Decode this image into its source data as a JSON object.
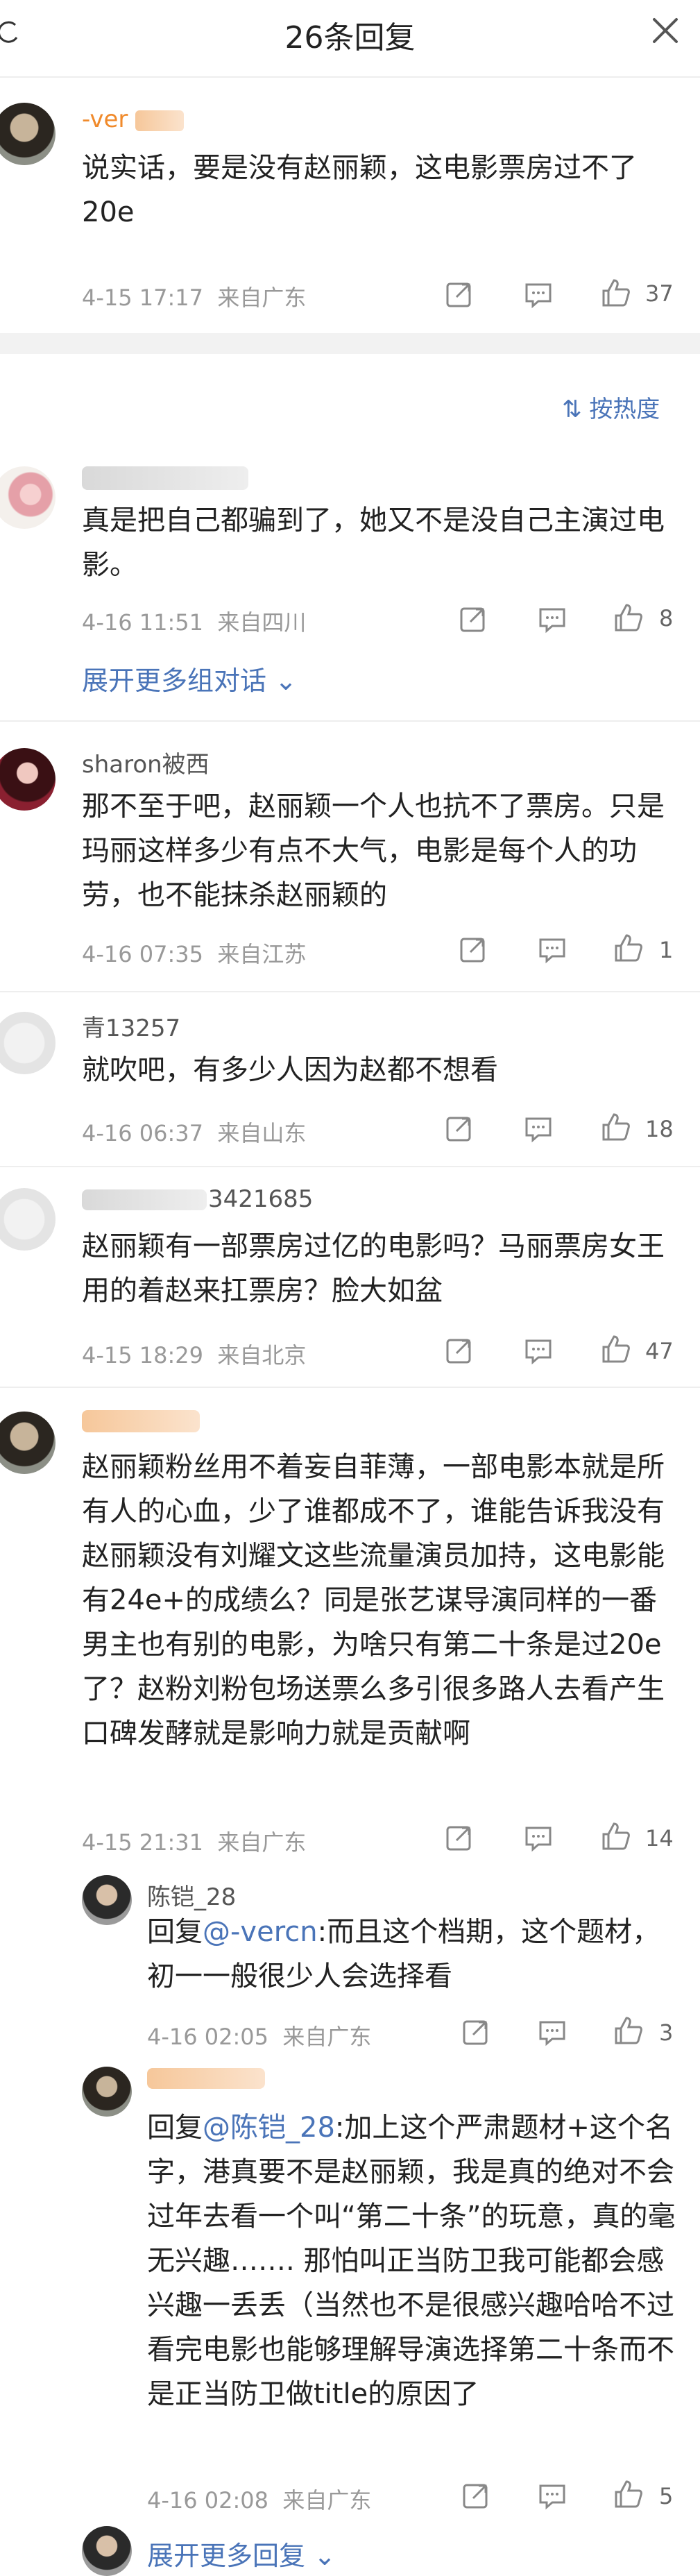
{
  "header": {
    "title": "26条回复"
  },
  "top_comment": {
    "username": "-ver",
    "text": "说实话，要是没有赵丽颖，这电影票房过不了20e",
    "time": "4-15 17:17",
    "location": "来自广东",
    "likes": "37"
  },
  "sort": {
    "label": "按热度"
  },
  "replies": [
    {
      "username": "",
      "text": "真是把自己都骗到了，她又不是没自己主演过电影。",
      "time": "4-16 11:51",
      "location": "来自四川",
      "likes": "8",
      "expand": "展开更多组对话"
    },
    {
      "username": "sharon被西",
      "text": "那不至于吧，赵丽颖一个人也抗不了票房。只是玛丽这样多少有点不大气，电影是每个人的功劳，也不能抹杀赵丽颖的",
      "time": "4-16 07:35",
      "location": "来自江苏",
      "likes": "1"
    },
    {
      "username": "青13257",
      "text": "就吹吧，有多少人因为赵都不想看",
      "time": "4-16 06:37",
      "location": "来自山东",
      "likes": "18"
    },
    {
      "username": "3421685",
      "text": "赵丽颖有一部票房过亿的电影吗？马丽票房女王用的着赵来扛票房？脸大如盆",
      "time": "4-15 18:29",
      "location": "来自北京",
      "likes": "47"
    },
    {
      "username": "",
      "text": "赵丽颖粉丝用不着妄自菲薄，一部电影本就是所有人的心血，少了谁都成不了，谁能告诉我没有赵丽颖没有刘耀文这些流量演员加持，这电影能有24e+的成绩么？同是张艺谋导演同样的一番男主也有别的电影，为啥只有第二十条是过20e了？赵粉刘粉包场送票么多引很多路人去看产生口碑发酵就是影响力就是贡献啊",
      "time": "4-15 21:31",
      "location": "来自广东",
      "likes": "14"
    }
  ],
  "sub_replies": [
    {
      "username": "陈铠_28",
      "prefix": "回复",
      "mention": "@-vercn",
      "text": ":而且这个档期，这个题材，初一一般很少人会选择看",
      "time": "4-16 02:05",
      "location": "来自广东",
      "likes": "3"
    },
    {
      "username": "",
      "prefix": "回复",
      "mention": "@陈铠_28",
      "text": ":加上这个严肃题材+这个名字，港真要不是赵丽颖，我是真的绝对不会过年去看一个叫“第二十条”的玩意，真的毫无兴趣……. 那怕叫正当防卫我可能都会感兴趣一丢丢（当然也不是很感兴趣哈哈不过看完电影也能够理解导演选择第二十条而不是正当防卫做title的原因了",
      "time": "4-16 02:08",
      "location": "来自广东",
      "likes": "5"
    }
  ],
  "more_replies": {
    "label": "展开更多回复"
  },
  "colors": {
    "link": "#4a74b8",
    "meta": "#999999",
    "gap": "#f2f2f2"
  }
}
